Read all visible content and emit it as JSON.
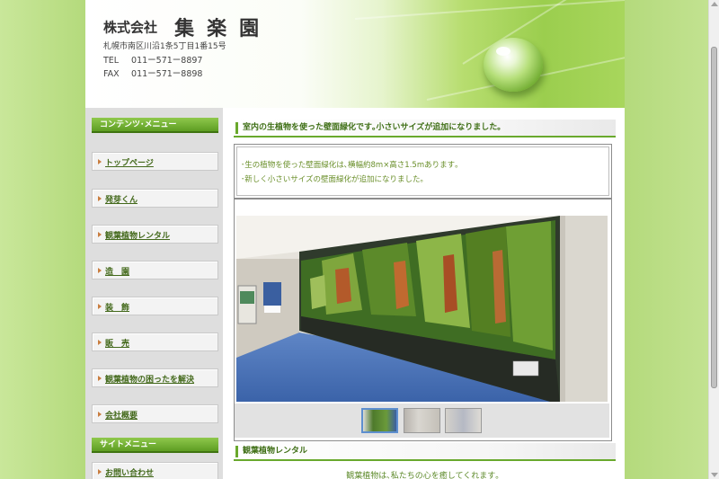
{
  "header": {
    "company_prefix": "株式会社",
    "company_name": "集楽園",
    "address": "札幌市南区川沿1条5丁目1番15号",
    "tel_label": "TEL",
    "tel": "011ー571ー8897",
    "fax_label": "FAX",
    "fax": "011ー571ー8898"
  },
  "sidebar": {
    "contents_heading": "コンテンツ･メニュー",
    "items": [
      {
        "label": "トップページ"
      },
      {
        "label": "発芽くん"
      },
      {
        "label": "観葉植物レンタル"
      },
      {
        "label": "造　園"
      },
      {
        "label": "装　飾"
      },
      {
        "label": "販　売"
      },
      {
        "label": "観葉植物の困ったを解決"
      },
      {
        "label": "会社概要"
      }
    ],
    "site_heading": "サイトメニュー",
    "site_items": [
      {
        "label": "お問い合わせ"
      }
    ]
  },
  "main": {
    "section1_title": "室内の生植物を使った壁面緑化です｡小さいサイズが追加になりました｡",
    "desc": [
      "･生の植物を使った壁面緑化は､横幅約8m×高さ1.5mあります｡",
      "･新しく小さいサイズの壁面緑化が追加になりました｡"
    ],
    "section2_title": "観葉植物レンタル",
    "section2_text": "観葉植物は､私たちの心を癒してくれます｡"
  },
  "colors": {
    "accent_green": "#69a92d",
    "link_green": "#43691b",
    "side_bg": "#dedede",
    "page_bg": "#b9dd86"
  }
}
